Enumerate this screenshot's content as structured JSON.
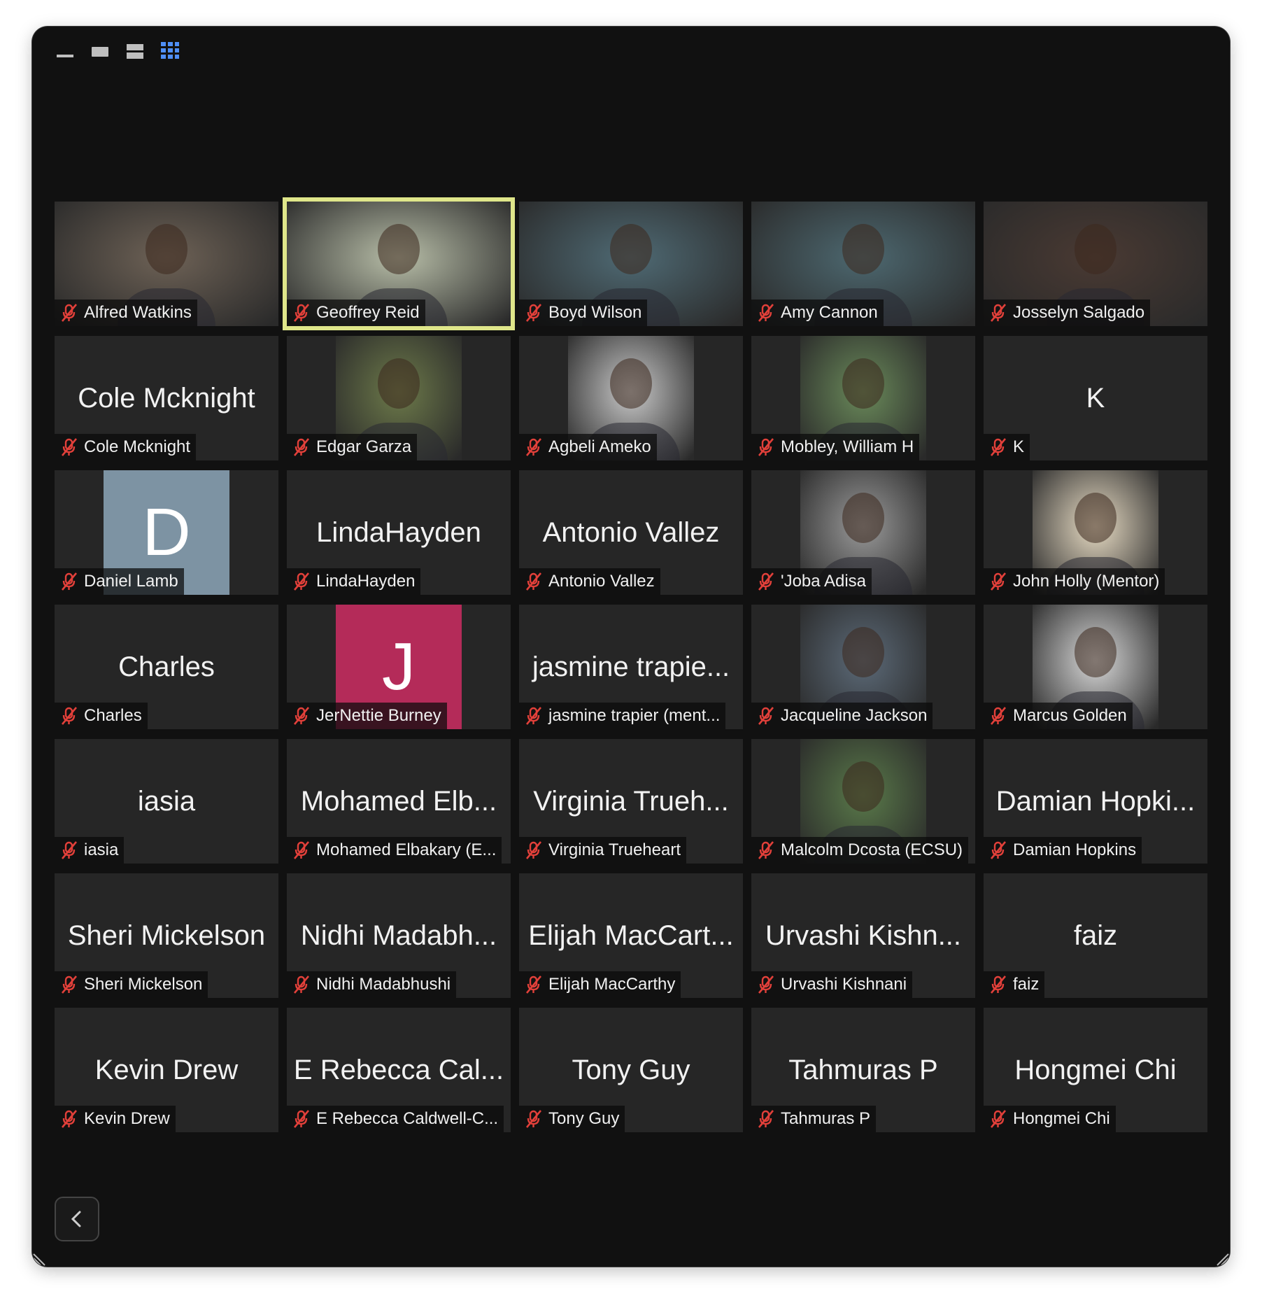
{
  "toolbar": {
    "icons": [
      "minimize-view-icon",
      "speaker-view-icon",
      "strip-view-icon",
      "gallery-view-icon"
    ],
    "active_color": "#4f8ff7"
  },
  "colors": {
    "mic_muted": "#e2403a",
    "active_speaker": "#dfe68a",
    "avatar_D": "#7d93a3",
    "avatar_J": "#b42b59"
  },
  "tiles": [
    {
      "label": "Alfred Watkins",
      "kind": "photo"
    },
    {
      "label": "Geoffrey Reid",
      "kind": "photo",
      "active": true
    },
    {
      "label": "Boyd Wilson",
      "kind": "photo"
    },
    {
      "label": "Amy Cannon",
      "kind": "photo"
    },
    {
      "label": "Josselyn Salgado",
      "kind": "photo"
    },
    {
      "label": "Cole Mcknight",
      "big": "Cole Mcknight"
    },
    {
      "label": "Edgar Garza",
      "kind": "photo-center"
    },
    {
      "label": "Agbeli Ameko",
      "kind": "photo-center"
    },
    {
      "label": "Mobley, William H",
      "kind": "photo-center"
    },
    {
      "label": "K",
      "big": "K"
    },
    {
      "label": "Daniel Lamb",
      "avatar": "D"
    },
    {
      "label": "LindaHayden",
      "big": "LindaHayden"
    },
    {
      "label": "Antonio Vallez",
      "big": "Antonio Vallez"
    },
    {
      "label": "'Joba Adisa",
      "kind": "photo-center"
    },
    {
      "label": "John Holly (Mentor)",
      "kind": "photo-center"
    },
    {
      "label": "Charles",
      "big": "Charles"
    },
    {
      "label": "JerNettie Burney",
      "avatar": "J"
    },
    {
      "label": "jasmine trapier (ment...",
      "big": "jasmine trapie..."
    },
    {
      "label": "Jacqueline Jackson",
      "kind": "photo-center"
    },
    {
      "label": "Marcus Golden",
      "kind": "photo-center"
    },
    {
      "label": "iasia",
      "big": "iasia"
    },
    {
      "label": "Mohamed Elbakary (E...",
      "big": "Mohamed Elb..."
    },
    {
      "label": "Virginia Trueheart",
      "big": "Virginia Trueh..."
    },
    {
      "label": "Malcolm Dcosta (ECSU)",
      "kind": "photo-center"
    },
    {
      "label": "Damian Hopkins",
      "big": "Damian Hopki..."
    },
    {
      "label": "Sheri Mickelson",
      "big": "Sheri Mickelson"
    },
    {
      "label": "Nidhi Madabhushi",
      "big": "Nidhi Madabh..."
    },
    {
      "label": "Elijah MacCarthy",
      "big": "Elijah MacCart..."
    },
    {
      "label": "Urvashi Kishnani",
      "big": "Urvashi Kishn..."
    },
    {
      "label": "faiz",
      "big": "faiz"
    },
    {
      "label": "Kevin Drew",
      "big": "Kevin Drew"
    },
    {
      "label": "E Rebecca Caldwell-C...",
      "big": "E Rebecca Cal..."
    },
    {
      "label": "Tony Guy",
      "big": "Tony Guy"
    },
    {
      "label": "Tahmuras P",
      "big": "Tahmuras P"
    },
    {
      "label": "Hongmei Chi",
      "big": "Hongmei Chi"
    }
  ],
  "photo_colors": [
    "#6e6256",
    "#b8bea8",
    "#4f6a74",
    "#4d6870",
    "#4a3a33",
    "",
    "#6d7a4a",
    "#c9c9c9",
    "#6a8a5a",
    "",
    "",
    "",
    "",
    "#9a9a9a",
    "#e8dcc4",
    "",
    "",
    "",
    "#5c6a78",
    "#d8d8d8",
    "",
    "",
    "",
    "#5a7a4a",
    "",
    "",
    "",
    "",
    "",
    "",
    "",
    "",
    "",
    "",
    ""
  ]
}
